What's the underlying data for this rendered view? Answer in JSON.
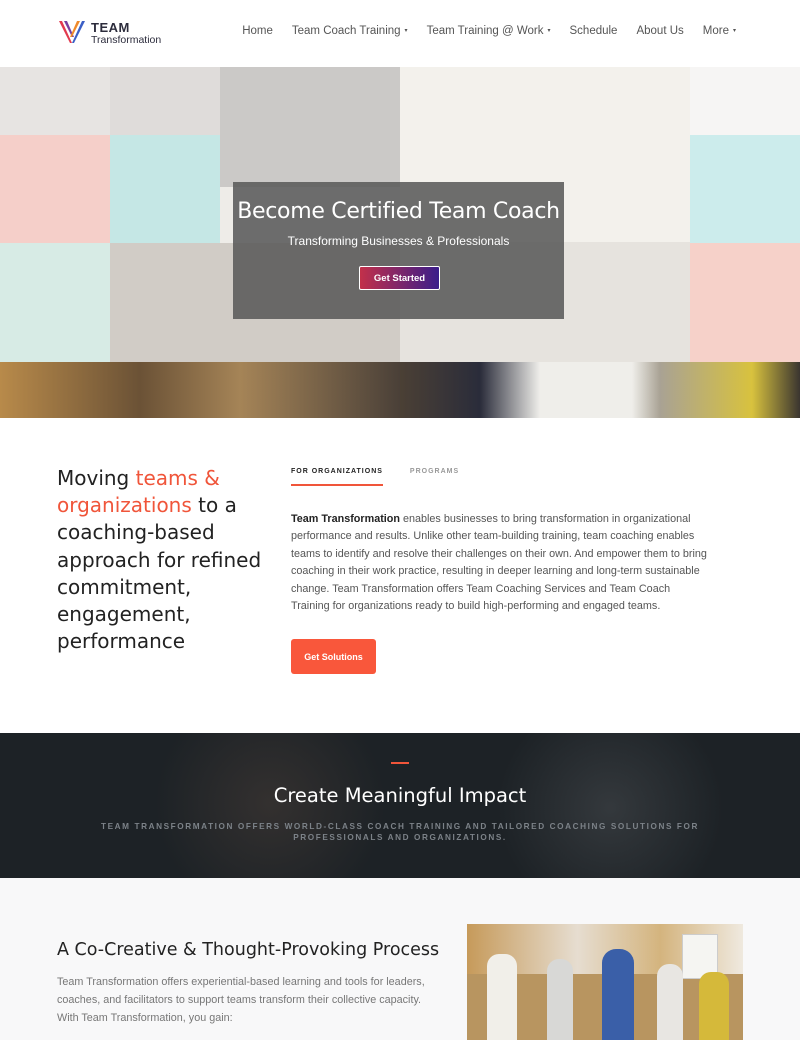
{
  "header": {
    "logo_line1": "TEAM",
    "logo_line2": "Transformation",
    "nav": [
      {
        "label": "Home",
        "caret": ""
      },
      {
        "label": "Team Coach Training",
        "caret": "▾"
      },
      {
        "label": "Team Training @ Work",
        "caret": "▾"
      },
      {
        "label": "Schedule",
        "caret": ""
      },
      {
        "label": "About Us",
        "caret": ""
      },
      {
        "label": "More",
        "caret": "▾"
      }
    ]
  },
  "hero": {
    "title": "Become Certified Team Coach",
    "subtitle": "Transforming Businesses & Professionals",
    "button": "Get Started"
  },
  "intro": {
    "heading_part1": "Moving ",
    "heading_accent": "teams & organizations",
    "heading_part2": " to a coaching-based approach for refined commitment, engagement, performance",
    "tabs": [
      {
        "label": "FOR ORGANIZATIONS",
        "active": true
      },
      {
        "label": "PROGRAMS",
        "active": false
      }
    ],
    "body_strong": "Team Transformation",
    "body_rest": " enables businesses to bring transformation in organizational performance and results. Unlike other team-building training, team coaching enables teams to identify and resolve their challenges on their own. And empower them to bring coaching in their work practice, resulting in deeper learning and long-term sustainable change. Team Transformation offers Team Coaching Services and Team Coach Training for organizations ready to build high-performing and engaged teams.",
    "button": "Get Solutions"
  },
  "impact": {
    "title": "Create Meaningful Impact",
    "subtitle": "TEAM TRANSFORMATION OFFERS WORLD-CLASS COACH TRAINING AND TAILORED COACHING SOLUTIONS FOR PROFESSIONALS AND ORGANIZATIONS."
  },
  "process": {
    "title": "A Co-Creative & Thought-Provoking Process",
    "body": "Team Transformation offers experiential-based learning and tools for leaders, coaches, and facilitators to support teams transform their collective capacity. With Team Transformation, you gain:"
  },
  "colors": {
    "accent": "#f0553a",
    "button_orange": "#f9573b",
    "dark_band": "#1d2226"
  }
}
